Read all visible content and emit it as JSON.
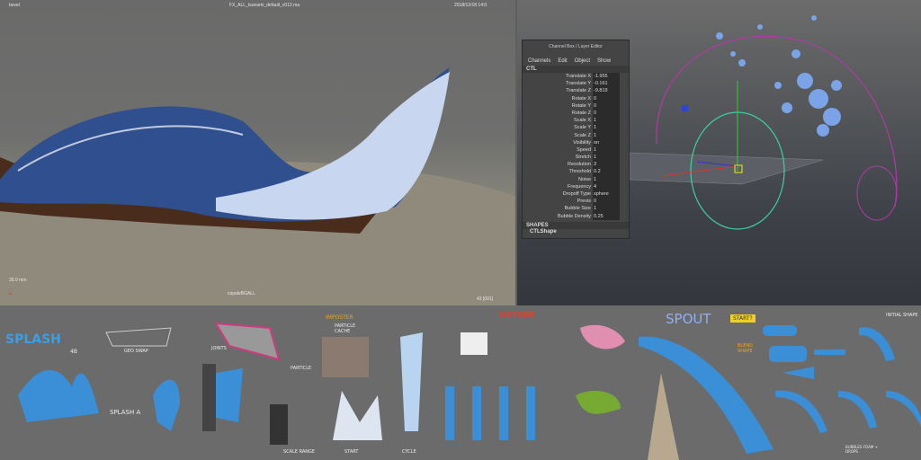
{
  "left_viewport": {
    "top_left": "bevel",
    "title": "FX_ALL_tsunami_default_v012.ma",
    "timestamp": "2018/12/18 14:0",
    "focal": "35.0 mm",
    "camera": "copaleBGALL",
    "frame": "43 [001]"
  },
  "channel_box": {
    "title": "Channel Box / Layer Editor",
    "menu": [
      "Channels",
      "Edit",
      "Object",
      "Show"
    ],
    "object": "CTL",
    "channels": [
      [
        "Translate X",
        "-1.955"
      ],
      [
        "Translate Y",
        "-0.161"
      ],
      [
        "Translate Z",
        "-9.819"
      ],
      [
        "Rotate X",
        "0"
      ],
      [
        "Rotate Y",
        "0"
      ],
      [
        "Rotate Z",
        "0"
      ],
      [
        "Scale X",
        "1"
      ],
      [
        "Scale Y",
        "1"
      ],
      [
        "Scale Z",
        "1"
      ],
      [
        "Visibility",
        "on"
      ],
      [
        "Speed",
        "1"
      ],
      [
        "Stretch",
        "1"
      ],
      [
        "Resolution",
        "3"
      ],
      [
        "Threshold",
        "0.2"
      ],
      [
        "Noise",
        "1"
      ],
      [
        "Frequency",
        "4"
      ],
      [
        "Dropoff Type",
        "sphere"
      ],
      [
        "Previs",
        "0"
      ],
      [
        "Bubble Size",
        "1"
      ],
      [
        "Bubble Density",
        "0.25"
      ]
    ],
    "shapes_label": "SHAPES",
    "shape_name": "CTLShape"
  },
  "concept_art": {
    "labels": [
      "SPLASH",
      "4B",
      "GEO SWAP",
      "JOINTS",
      "IMPOSTER",
      "PARTICLE CACHE",
      "PARTICLE",
      "SPLASH A",
      "SCALE RANGE",
      "START",
      "CYCLE",
      "GEYSER",
      "SPOUT",
      "START?",
      "BLEND SHAPE",
      "INITIAL SHAPE",
      "BUBBLES FOAM + DROPS"
    ]
  },
  "colors": {
    "blue": "#3a8fd6",
    "pink": "#e08fb0",
    "red": "#e04030"
  }
}
